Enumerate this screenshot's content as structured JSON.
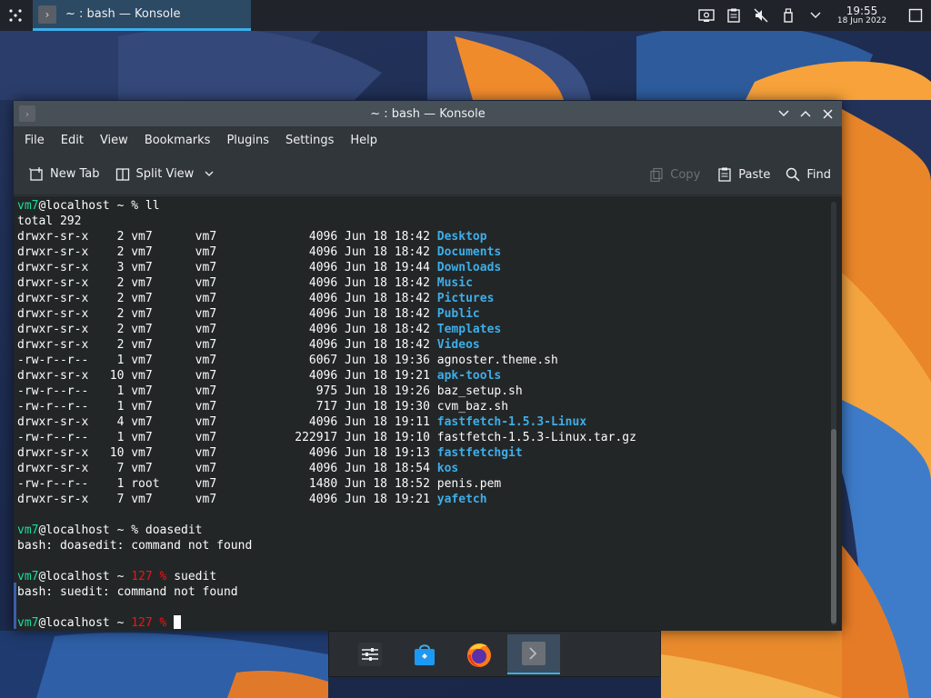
{
  "taskbar": {
    "active_task": "~ : bash — Konsole",
    "clock_time": "19:55",
    "clock_date": "18 Jun 2022"
  },
  "window": {
    "title": "~ : bash — Konsole",
    "menu": [
      "File",
      "Edit",
      "View",
      "Bookmarks",
      "Plugins",
      "Settings",
      "Help"
    ],
    "toolbar": {
      "new_tab": "New Tab",
      "split_view": "Split View",
      "copy": "Copy",
      "paste": "Paste",
      "find": "Find"
    }
  },
  "terminal": {
    "prompt_user": "vm7",
    "prompt_host": "@localhost ~ ",
    "cmd1": "% ll",
    "total": "total 292",
    "listing": [
      {
        "perm": "drwxr-sr-x",
        "links": "2",
        "owner": "vm7",
        "group": "vm7",
        "size": "4096",
        "date": "Jun 18 18:42",
        "name": "Desktop",
        "is_dir": true
      },
      {
        "perm": "drwxr-sr-x",
        "links": "2",
        "owner": "vm7",
        "group": "vm7",
        "size": "4096",
        "date": "Jun 18 18:42",
        "name": "Documents",
        "is_dir": true
      },
      {
        "perm": "drwxr-sr-x",
        "links": "3",
        "owner": "vm7",
        "group": "vm7",
        "size": "4096",
        "date": "Jun 18 19:44",
        "name": "Downloads",
        "is_dir": true
      },
      {
        "perm": "drwxr-sr-x",
        "links": "2",
        "owner": "vm7",
        "group": "vm7",
        "size": "4096",
        "date": "Jun 18 18:42",
        "name": "Music",
        "is_dir": true
      },
      {
        "perm": "drwxr-sr-x",
        "links": "2",
        "owner": "vm7",
        "group": "vm7",
        "size": "4096",
        "date": "Jun 18 18:42",
        "name": "Pictures",
        "is_dir": true
      },
      {
        "perm": "drwxr-sr-x",
        "links": "2",
        "owner": "vm7",
        "group": "vm7",
        "size": "4096",
        "date": "Jun 18 18:42",
        "name": "Public",
        "is_dir": true
      },
      {
        "perm": "drwxr-sr-x",
        "links": "2",
        "owner": "vm7",
        "group": "vm7",
        "size": "4096",
        "date": "Jun 18 18:42",
        "name": "Templates",
        "is_dir": true
      },
      {
        "perm": "drwxr-sr-x",
        "links": "2",
        "owner": "vm7",
        "group": "vm7",
        "size": "4096",
        "date": "Jun 18 18:42",
        "name": "Videos",
        "is_dir": true
      },
      {
        "perm": "-rw-r--r--",
        "links": "1",
        "owner": "vm7",
        "group": "vm7",
        "size": "6067",
        "date": "Jun 18 19:36",
        "name": "agnoster.theme.sh",
        "is_dir": false
      },
      {
        "perm": "drwxr-sr-x",
        "links": "10",
        "owner": "vm7",
        "group": "vm7",
        "size": "4096",
        "date": "Jun 18 19:21",
        "name": "apk-tools",
        "is_dir": true
      },
      {
        "perm": "-rw-r--r--",
        "links": "1",
        "owner": "vm7",
        "group": "vm7",
        "size": "975",
        "date": "Jun 18 19:26",
        "name": "baz_setup.sh",
        "is_dir": false
      },
      {
        "perm": "-rw-r--r--",
        "links": "1",
        "owner": "vm7",
        "group": "vm7",
        "size": "717",
        "date": "Jun 18 19:30",
        "name": "cvm_baz.sh",
        "is_dir": false
      },
      {
        "perm": "drwxr-sr-x",
        "links": "4",
        "owner": "vm7",
        "group": "vm7",
        "size": "4096",
        "date": "Jun 18 19:11",
        "name": "fastfetch-1.5.3-Linux",
        "is_dir": true
      },
      {
        "perm": "-rw-r--r--",
        "links": "1",
        "owner": "vm7",
        "group": "vm7",
        "size": "222917",
        "date": "Jun 18 19:10",
        "name": "fastfetch-1.5.3-Linux.tar.gz",
        "is_dir": false
      },
      {
        "perm": "drwxr-sr-x",
        "links": "10",
        "owner": "vm7",
        "group": "vm7",
        "size": "4096",
        "date": "Jun 18 19:13",
        "name": "fastfetchgit",
        "is_dir": true
      },
      {
        "perm": "drwxr-sr-x",
        "links": "7",
        "owner": "vm7",
        "group": "vm7",
        "size": "4096",
        "date": "Jun 18 18:54",
        "name": "kos",
        "is_dir": true
      },
      {
        "perm": "-rw-r--r--",
        "links": "1",
        "owner": "root",
        "group": "vm7",
        "size": "1480",
        "date": "Jun 18 18:52",
        "name": "penis.pem",
        "is_dir": false
      },
      {
        "perm": "drwxr-sr-x",
        "links": "7",
        "owner": "vm7",
        "group": "vm7",
        "size": "4096",
        "date": "Jun 18 19:21",
        "name": "yafetch",
        "is_dir": true
      }
    ],
    "cmd2": "% doasedit",
    "err2": "bash: doasedit: command not found",
    "status3": "127 %",
    "cmd3": " suedit",
    "err3": "bash: suedit: command not found",
    "status4": "127 %"
  },
  "colors": {
    "accent": "#3daee9",
    "prompt_green": "#1cdc9a",
    "error_red": "#ed1515",
    "terminal_bg": "#232627"
  },
  "dock": [
    "settings-icon",
    "discover-store-icon",
    "firefox-icon",
    "konsole-icon"
  ]
}
